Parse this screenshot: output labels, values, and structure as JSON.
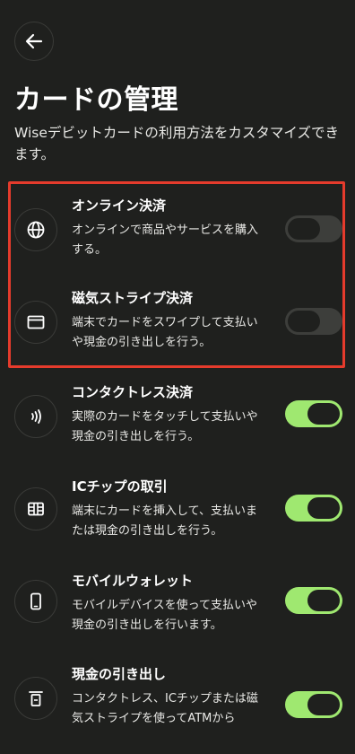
{
  "header": {
    "back_icon": "arrow-left-icon"
  },
  "page": {
    "title": "カードの管理",
    "description": "Wiseデビットカードの利用方法をカスタマイズできます。"
  },
  "colors": {
    "background": "#1f201e",
    "toggle_on": "#9fe870",
    "toggle_off": "#3d3e3b",
    "highlight": "#e53b2c"
  },
  "settings": [
    {
      "icon": "globe-icon",
      "title": "オンライン決済",
      "description": "オンラインで商品やサービスを購入する。",
      "enabled": false
    },
    {
      "icon": "card-icon",
      "title": "磁気ストライプ決済",
      "description": "端末でカードをスワイプして支払いや現金の引き出しを行う。",
      "enabled": false
    },
    {
      "icon": "contactless-icon",
      "title": "コンタクトレス決済",
      "description": "実際のカードをタッチして支払いや現金の引き出しを行う。",
      "enabled": true
    },
    {
      "icon": "chip-icon",
      "title": "ICチップの取引",
      "description": "端末にカードを挿入して、支払いまたは現金の引き出しを行う。",
      "enabled": true
    },
    {
      "icon": "phone-icon",
      "title": "モバイルウォレット",
      "description": "モバイルデバイスを使って支払いや現金の引き出しを行います。",
      "enabled": true
    },
    {
      "icon": "cash-icon",
      "title": "現金の引き出し",
      "description": "コンタクトレス、ICチップまたは磁気ストライプを使ってATMから",
      "enabled": true
    }
  ]
}
